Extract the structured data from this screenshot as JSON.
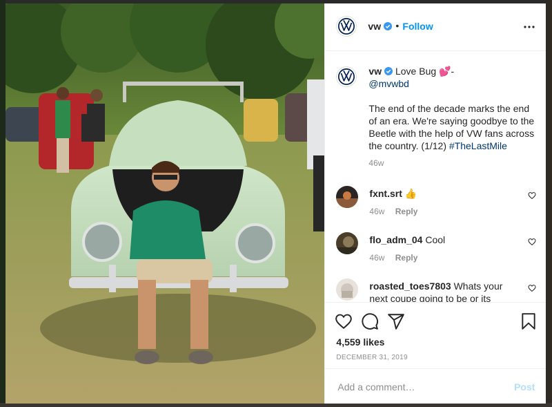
{
  "brand": {
    "accent": "#0095f6",
    "verified": "#3897f0"
  },
  "header": {
    "username": "vw",
    "separator": "•",
    "follow_label": "Follow"
  },
  "caption": {
    "username": "vw",
    "line1": "Love Bug 💕-",
    "mention": "@mvwbd",
    "body": "The end of the decade marks the end of an era. We're saying goodbye to the Beetle with the help of VW fans across the country. (1/12)",
    "hashtag": "#TheLastMile",
    "time": "46w"
  },
  "comments": [
    {
      "username": "fxnt.srt",
      "text": "👍",
      "time": "46w",
      "reply_label": "Reply"
    },
    {
      "username": "flo_adm_04",
      "text": "Cool",
      "time": "46w",
      "reply_label": "Reply"
    },
    {
      "username": "roasted_toes7803",
      "text": "Whats your next coupe going to be or its"
    }
  ],
  "actions": {
    "icons": [
      "heart-icon",
      "comment-icon",
      "share-icon",
      "bookmark-icon"
    ],
    "likes": "4,559 likes",
    "date": "DECEMBER 31, 2019"
  },
  "composer": {
    "placeholder": "Add a comment…",
    "post_label": "Post"
  }
}
